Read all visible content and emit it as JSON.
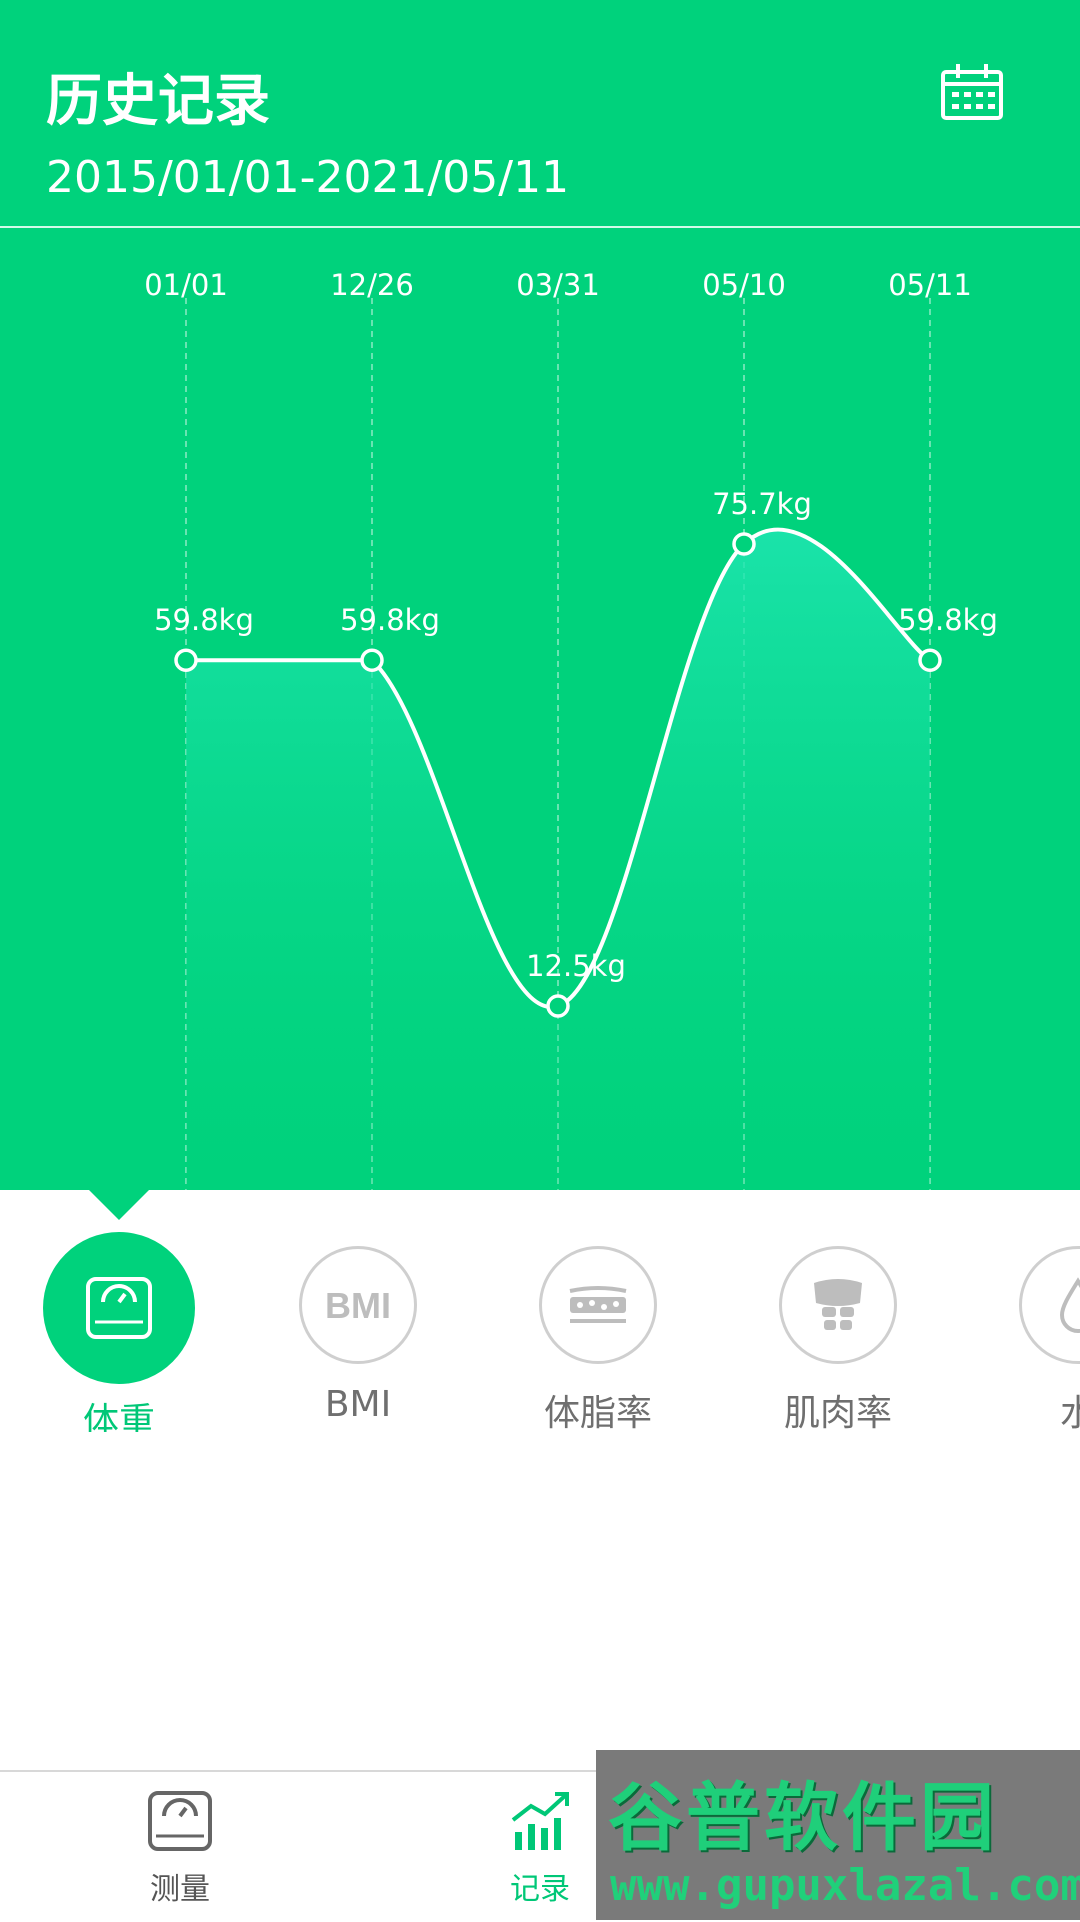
{
  "header": {
    "title": "历史记录",
    "date_range": "2015/01/01-2021/05/11",
    "calendar_icon": "calendar-icon",
    "background_color": "#00d27c"
  },
  "chart_data": {
    "type": "area",
    "categories": [
      "01/01",
      "12/26",
      "03/31",
      "05/10",
      "05/11"
    ],
    "values": [
      59.8,
      59.8,
      12.5,
      75.7,
      59.8
    ],
    "value_labels": [
      "59.8kg",
      "59.8kg",
      "12.5kg",
      "75.7kg",
      "59.8kg"
    ],
    "unit": "kg",
    "grid": "dashed vertical lines",
    "line_color": "#ffffff",
    "fill_color": "#00e6a0"
  },
  "metrics": [
    {
      "label": "体重",
      "icon": "scale-icon",
      "active": true
    },
    {
      "label": "BMI",
      "icon": "bmi-icon",
      "active": false
    },
    {
      "label": "体脂率",
      "icon": "body-fat-icon",
      "active": false
    },
    {
      "label": "肌肉率",
      "icon": "muscle-icon",
      "active": false
    },
    {
      "label": "水",
      "icon": "water-drop-icon",
      "active": false
    }
  ],
  "bottom_nav": [
    {
      "label": "测量",
      "icon": "scale-icon",
      "active": false
    },
    {
      "label": "记录",
      "icon": "trend-chart-icon",
      "active": true
    }
  ],
  "watermark": {
    "title": "谷普软件园",
    "url": "www.gupuxlazal.com"
  }
}
